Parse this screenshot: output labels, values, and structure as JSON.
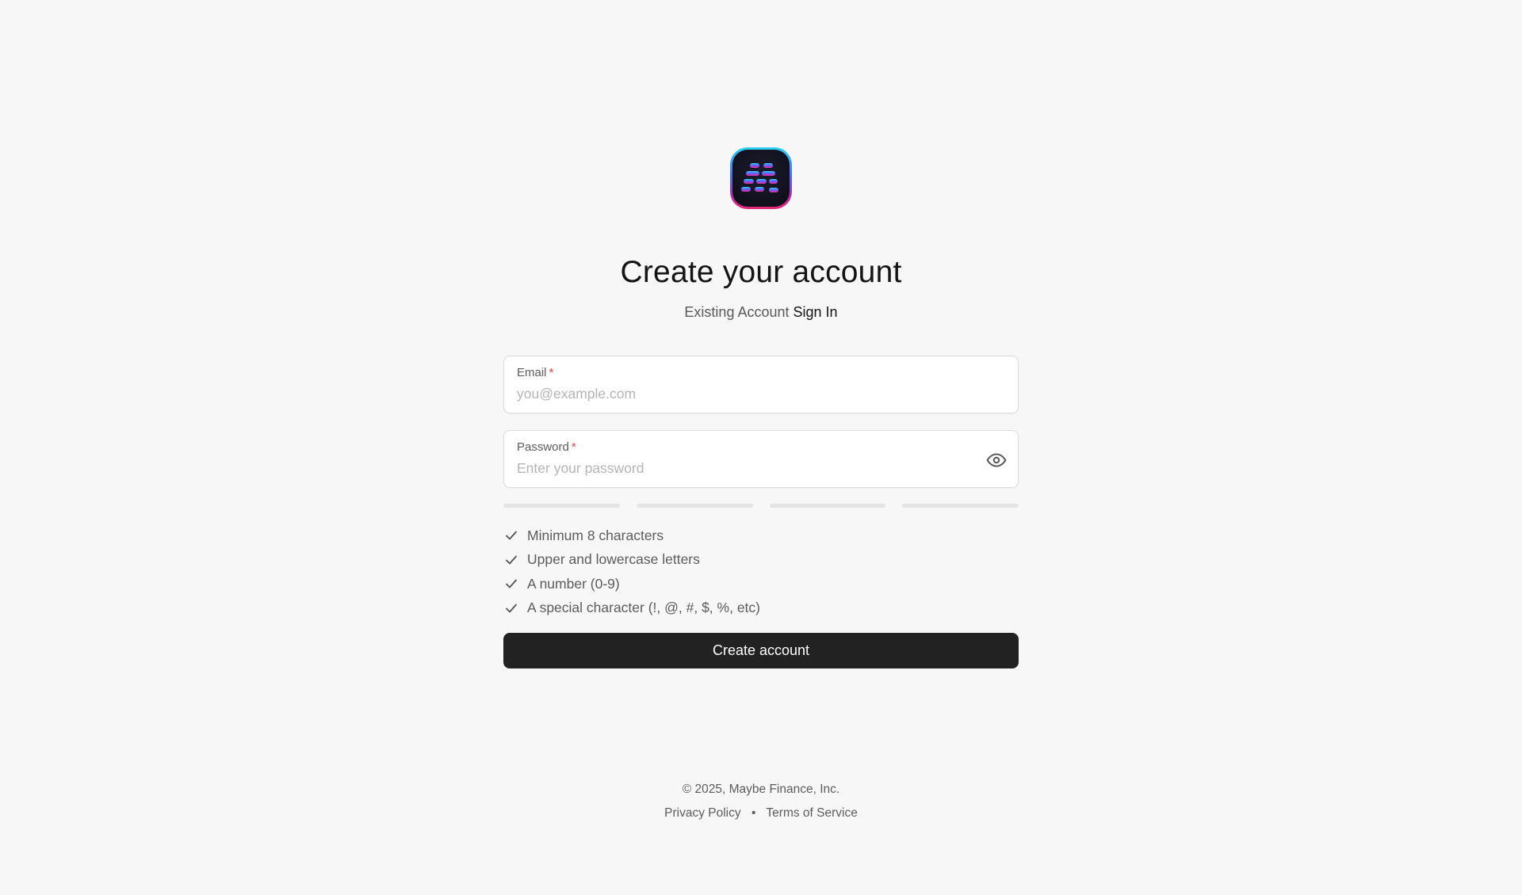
{
  "header": {
    "title": "Create your account",
    "existing_account_text": "Existing Account",
    "sign_in_label": "Sign In"
  },
  "form": {
    "email": {
      "label": "Email",
      "required_mark": "*",
      "placeholder": "you@example.com",
      "value": ""
    },
    "password": {
      "label": "Password",
      "required_mark": "*",
      "placeholder": "Enter your password",
      "value": "",
      "toggle_icon": "eye-icon"
    },
    "strength_meter": {
      "segments": 4,
      "filled": 0
    },
    "requirements": [
      {
        "icon": "check-icon",
        "label": "Minimum 8 characters"
      },
      {
        "icon": "check-icon",
        "label": "Upper and lowercase letters"
      },
      {
        "icon": "check-icon",
        "label": "A number (0-9)"
      },
      {
        "icon": "check-icon",
        "label": "A special character (!, @, #, $, %, etc)"
      }
    ],
    "submit_label": "Create account"
  },
  "footer": {
    "copyright": "© 2025, Maybe Finance, Inc.",
    "privacy_label": "Privacy Policy",
    "separator": "•",
    "terms_label": "Terms of Service"
  },
  "colors": {
    "background": "#f7f7f7",
    "primary_button": "#222222",
    "required": "#e5484d",
    "strength_empty": "#e4e4e4"
  }
}
